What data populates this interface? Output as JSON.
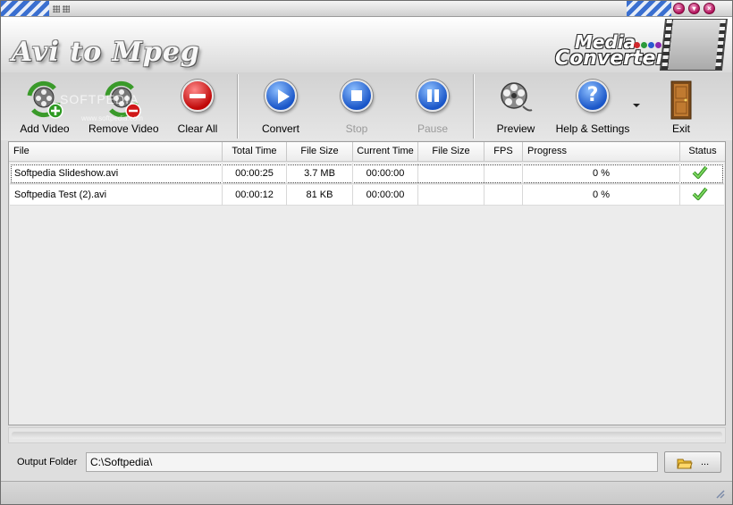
{
  "window": {
    "app_title": "Avi to Mpeg",
    "brand_line1": "Media",
    "brand_line2": "Converters",
    "brand_dot_colors": [
      "#d0282c",
      "#2a9a3a",
      "#2a5ad0",
      "#8a2ab0"
    ],
    "controls": [
      "minimize-icon",
      "maximize-icon",
      "close-icon"
    ]
  },
  "toolbar": {
    "add_video": "Add Video",
    "remove_video": "Remove Video",
    "clear_all": "Clear All",
    "convert": "Convert",
    "stop": "Stop",
    "pause": "Pause",
    "preview": "Preview",
    "help_settings": "Help & Settings",
    "exit": "Exit",
    "watermark": "SOFTPEDIA",
    "watermark_url": "www.softpedia.com"
  },
  "table": {
    "headers": [
      "File",
      "Total Time",
      "File Size",
      "Current Time",
      "File Size",
      "FPS",
      "Progress",
      "Status"
    ],
    "rows": [
      {
        "file": "Softpedia Slideshow.avi",
        "total_time": "00:00:25",
        "file_size": "3.7 MB",
        "current_time": "00:00:00",
        "out_size": "",
        "fps": "",
        "progress": "0 %",
        "status": "check-icon"
      },
      {
        "file": "Softpedia Test (2).avi",
        "total_time": "00:00:12",
        "file_size": "81 KB",
        "current_time": "00:00:00",
        "out_size": "",
        "fps": "",
        "progress": "0 %",
        "status": "check-icon"
      }
    ]
  },
  "output": {
    "label": "Output Folder",
    "value": "C:\\Softpedia\\",
    "browse_label": "..."
  },
  "colors": {
    "accent_blue": "#2f6fd8",
    "clear_red": "#d01818",
    "status_green": "#3aa82a"
  }
}
